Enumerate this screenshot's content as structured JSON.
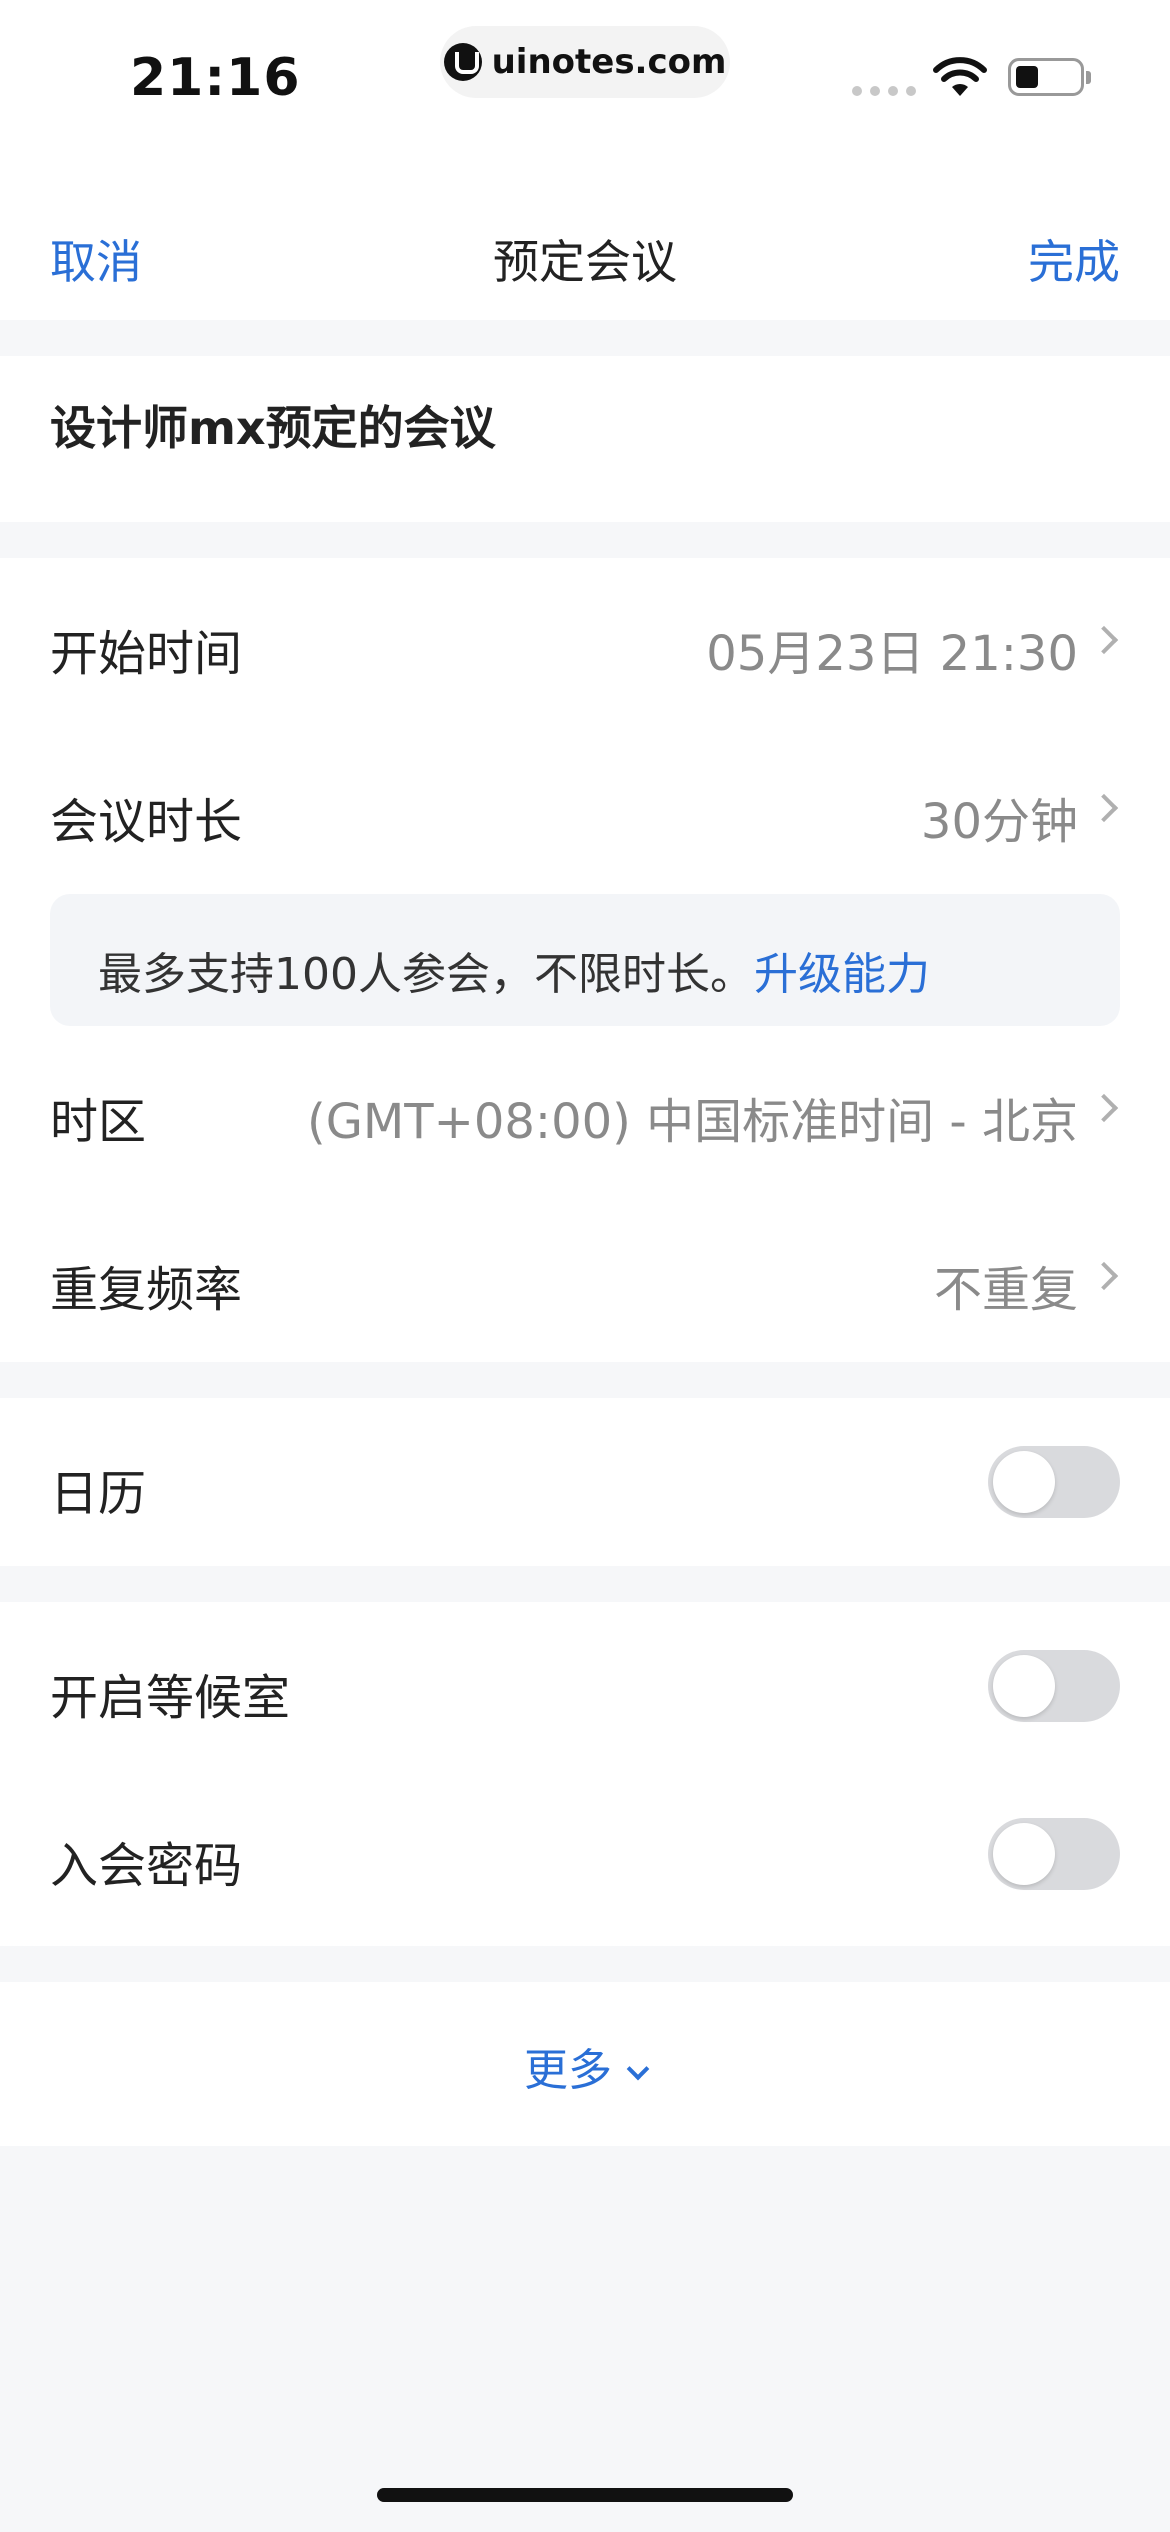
{
  "status_bar": {
    "time": "21:16",
    "url": "uinotes.com",
    "icons": [
      "signal-icon",
      "wifi-icon",
      "battery-icon"
    ]
  },
  "nav": {
    "cancel_label": "取消",
    "title": "预定会议",
    "done_label": "完成"
  },
  "meeting": {
    "title": "设计师mx预定的会议"
  },
  "schedule": {
    "start_time": {
      "label": "开始时间",
      "value": "05月23日 21:30"
    },
    "duration": {
      "label": "会议时长",
      "value": "30分钟"
    },
    "notice": {
      "text": "最多支持100人参会，不限时长。",
      "link": "升级能力"
    },
    "timezone": {
      "label": "时区",
      "value": "(GMT+08:00) 中国标准时间 - 北京"
    },
    "repeat": {
      "label": "重复频率",
      "value": "不重复"
    }
  },
  "calendar": {
    "label": "日历",
    "enabled": false
  },
  "security": {
    "waiting_room": {
      "label": "开启等候室",
      "enabled": false
    },
    "password": {
      "label": "入会密码",
      "enabled": false
    }
  },
  "more_label": "更多",
  "colors": {
    "accent": "#2a6fd6",
    "toggle_off": "#d9dadd",
    "background": "#f6f7f9"
  }
}
